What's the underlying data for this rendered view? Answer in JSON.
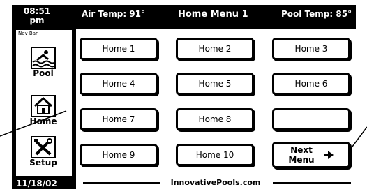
{
  "header": {
    "time": "08:51 pm",
    "air_temp": "Air Temp: 91°",
    "title": "Home Menu 1",
    "pool_temp": "Pool Temp: 85°"
  },
  "nav": {
    "label": "Nav Bar",
    "items": [
      {
        "label": "Pool",
        "icon": "swimmer-icon"
      },
      {
        "label": "Home",
        "icon": "house-icon"
      },
      {
        "label": "Setup",
        "icon": "tools-icon"
      }
    ]
  },
  "date": "11/18/02",
  "grid": [
    [
      "Home 1",
      "Home 2",
      "Home 3"
    ],
    [
      "Home 4",
      "Home 5",
      "Home 6"
    ],
    [
      "Home 7",
      "Home 8",
      ""
    ],
    [
      "Home 9",
      "Home 10",
      "Next Menu"
    ]
  ],
  "next": {
    "line1": "Next",
    "line2": "Menu",
    "icon": "arrow-right-icon"
  },
  "footer": {
    "site": "InnovativePools.com"
  }
}
